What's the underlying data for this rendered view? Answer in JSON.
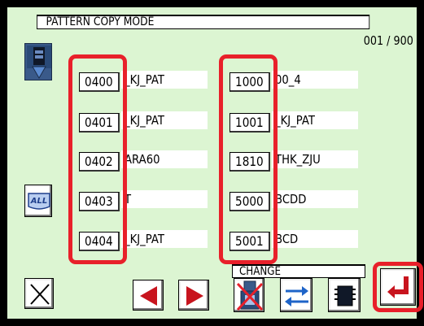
{
  "header": {
    "title": "PATTERN COPY MODE",
    "page_counter": "001 / 900"
  },
  "left_column": [
    {
      "number": "0400",
      "name": "_KJ_PAT"
    },
    {
      "number": "0401",
      "name": "_KJ_PAT"
    },
    {
      "number": "0402",
      "name": "ARA60"
    },
    {
      "number": "0403",
      "name": "T"
    },
    {
      "number": "0404",
      "name": "_KJ_PAT"
    }
  ],
  "right_column": [
    {
      "number": "1000",
      "name": "00_4"
    },
    {
      "number": "1001",
      "name": "_KJ_PAT"
    },
    {
      "number": "1810",
      "name": "THK_ZJU"
    },
    {
      "number": "5000",
      "name": "BCDD"
    },
    {
      "number": "5001",
      "name": "BCD"
    }
  ],
  "side_buttons": {
    "all_label": "ALL"
  },
  "bottom_bar": {
    "change_label": "CHANGE"
  },
  "colors": {
    "screen_bg": "#dcf5d2",
    "highlight_red": "#e8202a",
    "arrow_red": "#c8141e",
    "swap_blue": "#1e64c8",
    "enter_red": "#c8141e"
  }
}
